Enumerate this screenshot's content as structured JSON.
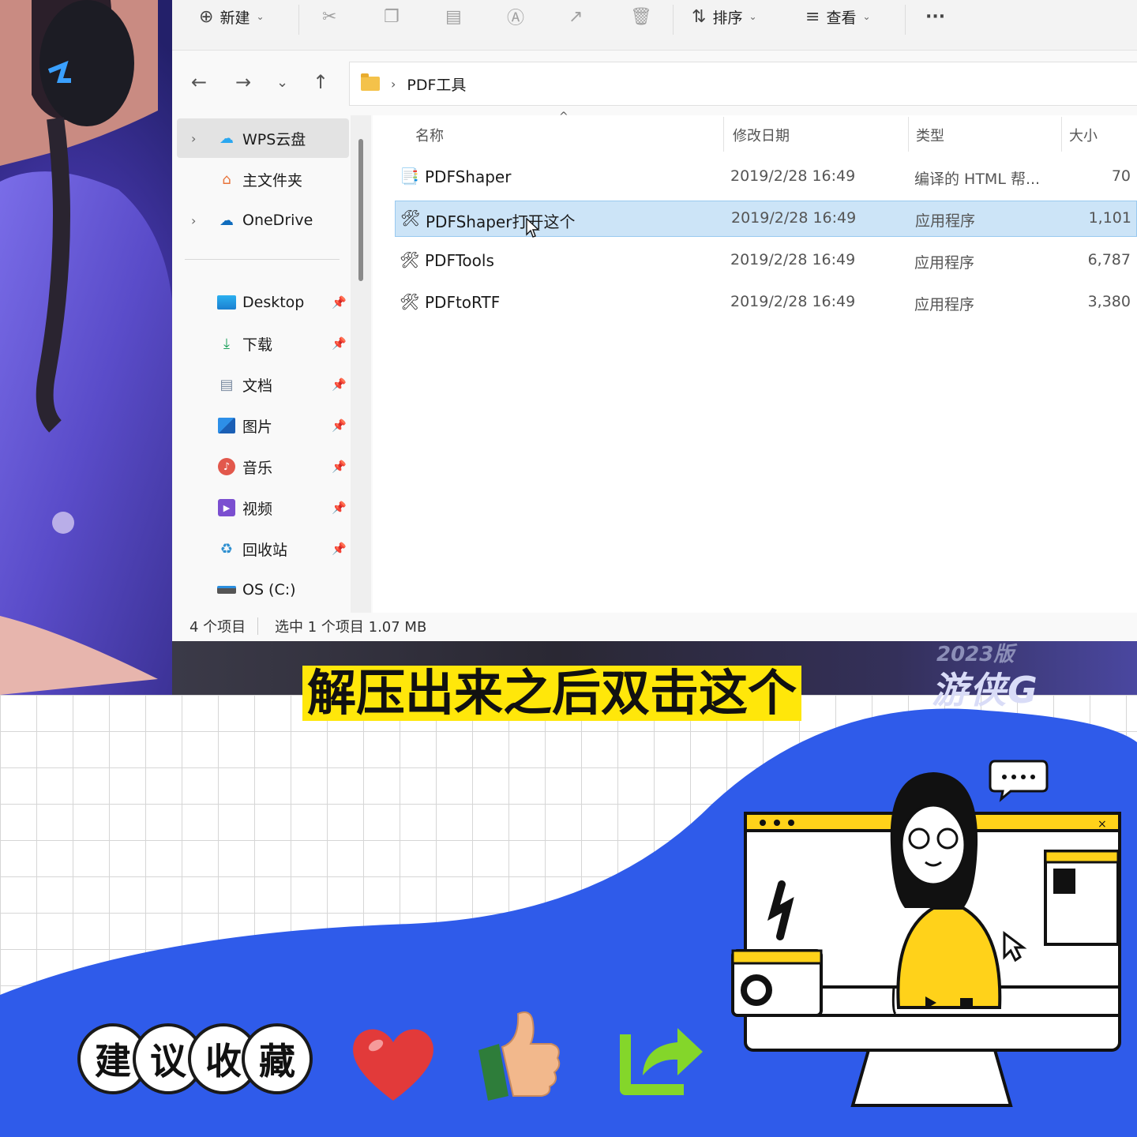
{
  "toolbar": {
    "new_label": "新建",
    "sort_label": "排序",
    "view_label": "查看",
    "more_label": "···"
  },
  "address": {
    "folder": "PDF工具"
  },
  "sidebar": {
    "items": [
      {
        "label": "WPS云盘"
      },
      {
        "label": "主文件夹"
      },
      {
        "label": "OneDrive"
      },
      {
        "label": "Desktop"
      },
      {
        "label": "下载"
      },
      {
        "label": "文档"
      },
      {
        "label": "图片"
      },
      {
        "label": "音乐"
      },
      {
        "label": "视频"
      },
      {
        "label": "回收站"
      },
      {
        "label": "OS (C:)"
      }
    ]
  },
  "columns": {
    "name": "名称",
    "date": "修改日期",
    "type": "类型",
    "size": "大小"
  },
  "files": [
    {
      "name": "PDFShaper",
      "date": "2019/2/28 16:49",
      "type": "编译的 HTML 帮...",
      "size": "70"
    },
    {
      "name": "PDFShaper打开这个",
      "date": "2019/2/28 16:49",
      "type": "应用程序",
      "size": "1,101"
    },
    {
      "name": "PDFTools",
      "date": "2019/2/28 16:49",
      "type": "应用程序",
      "size": "6,787"
    },
    {
      "name": "PDFtoRTF",
      "date": "2019/2/28 16:49",
      "type": "应用程序",
      "size": "3,380"
    }
  ],
  "status": {
    "count": "4 个项目",
    "selection": "选中 1 个项目  1.07 MB"
  },
  "caption": "解压出来之后双击这个",
  "brand": {
    "year": "2023版",
    "text": "游侠G"
  },
  "save_chars": [
    "建",
    "议",
    "收",
    "藏"
  ],
  "colors": {
    "accent_blue": "#2f5bea",
    "caption_yellow": "#ffe70a",
    "selection_blue": "#cce4f7"
  }
}
